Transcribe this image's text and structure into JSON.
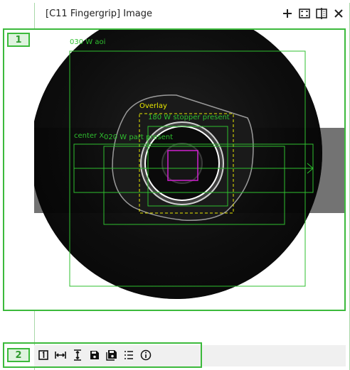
{
  "window": {
    "title": "[C11 Fingergrip] Image",
    "icons": [
      "add-icon",
      "fit-frame-icon",
      "split-view-icon",
      "close-icon"
    ]
  },
  "markers": {
    "m1": "1",
    "m2": "2"
  },
  "overlay_labels": {
    "aoi": "030 W aoi",
    "overlay": "Overlay",
    "stopper": "180 W stopper present",
    "center": "center X",
    "part": "020 W part present"
  },
  "toolbar": {
    "icons": [
      "frame-one-icon",
      "fit-width-icon",
      "fit-height-icon",
      "save-icon",
      "save-all-icon",
      "list-icon",
      "info-icon"
    ]
  },
  "colors": {
    "accent_green": "#3cba3c",
    "overlay_yellow": "#e8e800",
    "overlay_magenta": "#d020d0",
    "roi_green": "#2fbf2f"
  }
}
